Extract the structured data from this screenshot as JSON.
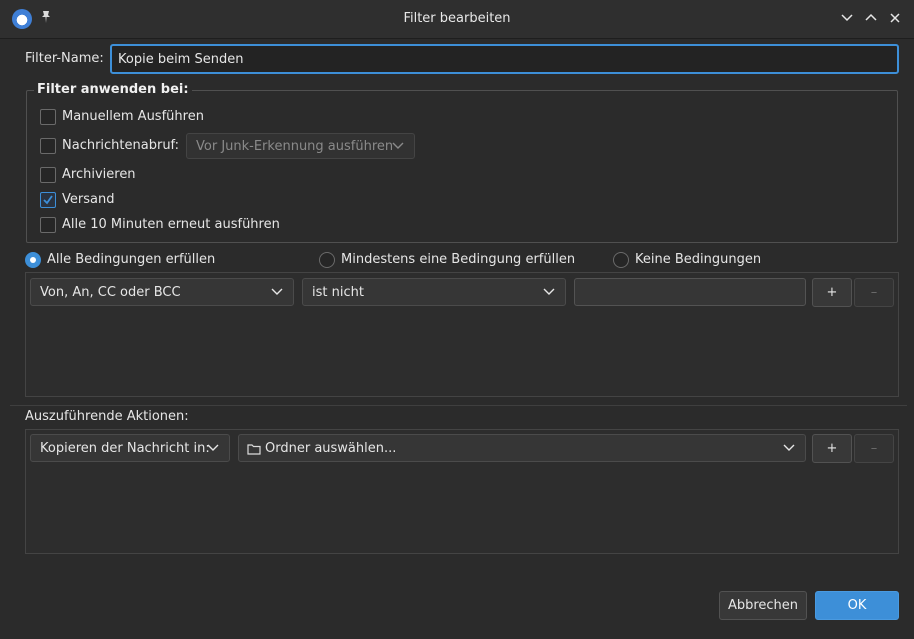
{
  "window": {
    "title": "Filter bearbeiten"
  },
  "filter_name": {
    "label": "Filter-Name:",
    "value": "Kopie beim Senden"
  },
  "apply_group": {
    "title": "Filter anwenden bei:",
    "options": [
      {
        "label": "Manuellem Ausführen",
        "checked": false
      },
      {
        "label": "Nachrichtenabruf:",
        "checked": false
      },
      {
        "label": "Archivieren",
        "checked": false
      },
      {
        "label": "Versand",
        "checked": true
      },
      {
        "label": "Alle 10 Minuten erneut ausführen",
        "checked": false
      }
    ],
    "junk_select": "Vor Junk-Erkennung ausführen"
  },
  "match": {
    "options": [
      {
        "label": "Alle Bedingungen erfüllen",
        "selected": true
      },
      {
        "label": "Mindestens eine Bedingung erfüllen",
        "selected": false
      },
      {
        "label": "Keine Bedingungen",
        "selected": false
      }
    ]
  },
  "condition": {
    "field": "Von, An, CC oder BCC",
    "operator": "ist nicht",
    "value": "",
    "add": "+",
    "remove": "–"
  },
  "actions": {
    "label": "Auszuführende Aktionen:",
    "action": "Kopieren der Nachricht in:",
    "folder": "Ordner auswählen...",
    "add": "+",
    "remove": "–"
  },
  "footer": {
    "cancel": "Abbrechen",
    "ok": "OK"
  },
  "colors": {
    "accent": "#3d8fd8",
    "background": "#2b2b2b"
  }
}
